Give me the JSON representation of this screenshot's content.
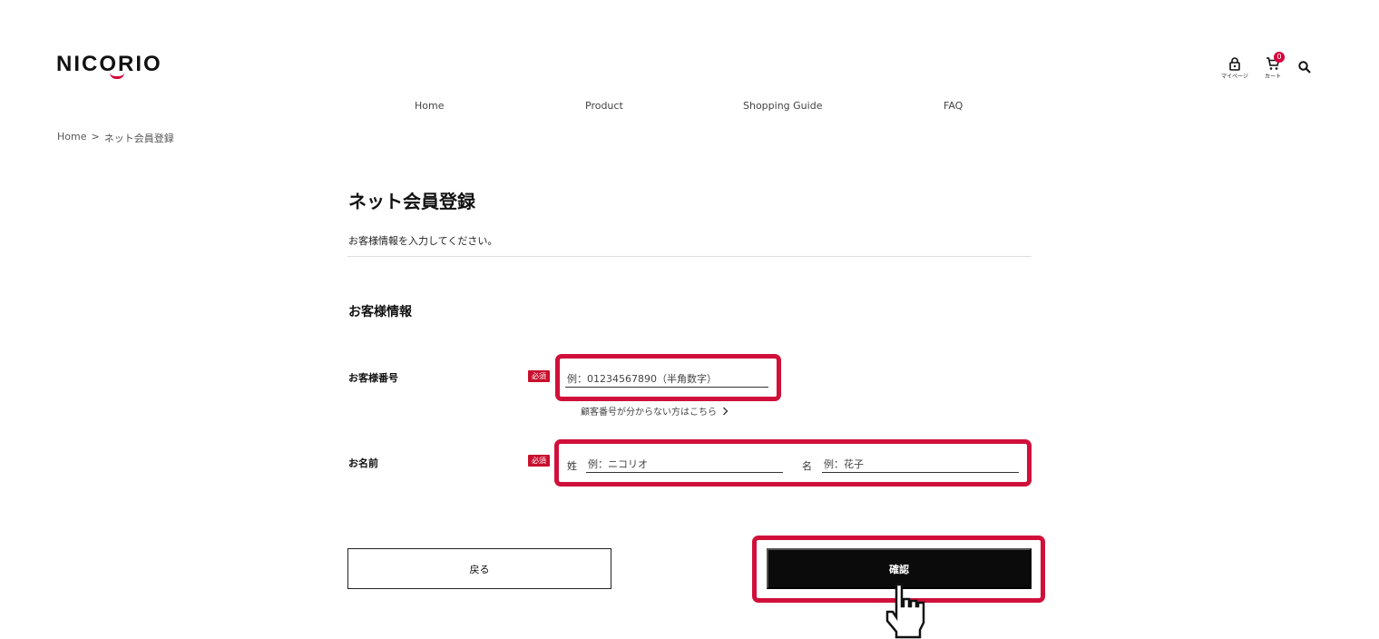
{
  "header": {
    "logo": "NICORIO",
    "mypage_label": "マイページ",
    "cart_label": "カート",
    "cart_count": "0",
    "icons": [
      "lock-icon",
      "cart-icon",
      "search-icon"
    ]
  },
  "nav": {
    "items": [
      "Home",
      "Product",
      "Shopping Guide",
      "FAQ"
    ]
  },
  "breadcrumb": {
    "home": "Home",
    "separator": ">",
    "current": "ネット会員登録"
  },
  "main": {
    "title": "ネット会員登録",
    "intro": "お客様情報を入力してください。",
    "section_title": "お客様情報"
  },
  "form": {
    "required_label": "必須",
    "customer_number": {
      "label": "お客様番号",
      "placeholder": "例：01234567890（半角数字）",
      "help_link": "顧客番号が分からない方はこちら"
    },
    "name": {
      "label": "お名前",
      "last_prefix": "姓",
      "last_placeholder": "例：ニコリオ",
      "first_prefix": "名",
      "first_placeholder": "例：花子"
    }
  },
  "buttons": {
    "back": "戻る",
    "confirm": "確認"
  },
  "colors": {
    "accent": "#d0103a",
    "required_badge": "#c8102e",
    "confirm_bg": "#0b0b0b"
  }
}
